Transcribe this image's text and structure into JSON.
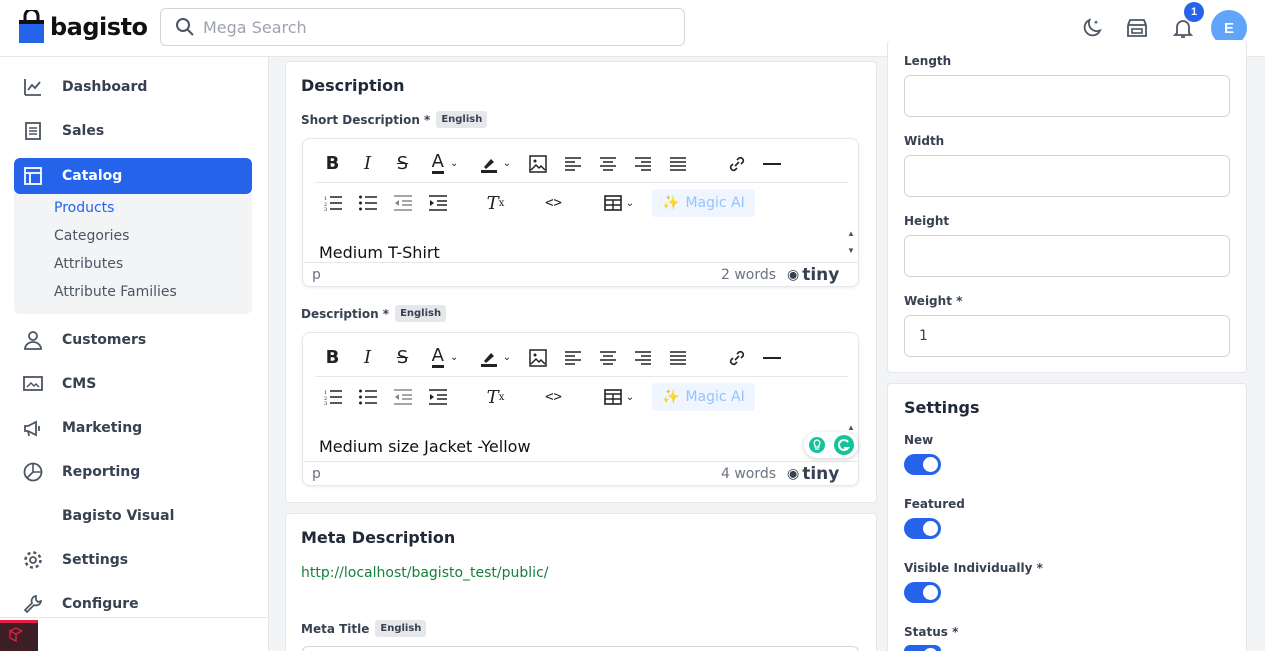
{
  "header": {
    "logo_text": "bagisto",
    "search_placeholder": "Mega Search",
    "notification_count": "1",
    "avatar_initial": "E",
    "accent_color": "#2563eb"
  },
  "sidebar": {
    "items": [
      {
        "label": "Dashboard",
        "icon": "dashboard-icon"
      },
      {
        "label": "Sales",
        "icon": "sales-icon"
      },
      {
        "label": "Catalog",
        "icon": "catalog-icon"
      },
      {
        "label": "Customers",
        "icon": "customers-icon"
      },
      {
        "label": "CMS",
        "icon": "cms-icon"
      },
      {
        "label": "Marketing",
        "icon": "marketing-icon"
      },
      {
        "label": "Reporting",
        "icon": "reporting-icon"
      },
      {
        "label": "Bagisto Visual",
        "icon": ""
      },
      {
        "label": "Settings",
        "icon": "settings-icon"
      },
      {
        "label": "Configure",
        "icon": "configure-icon"
      }
    ],
    "catalog_sub": [
      "Products",
      "Categories",
      "Attributes",
      "Attribute Families"
    ]
  },
  "description_card": {
    "title": "Description",
    "short_label": "Short Description *",
    "short_lang": "English",
    "short_content": "Medium T-Shirt",
    "short_path": "p",
    "short_words": "2 words",
    "desc_label": "Description *",
    "desc_lang": "English",
    "desc_content": "Medium size Jacket -Yellow",
    "desc_path": "p",
    "desc_words": "4 words",
    "magic_ai": "Magic AI",
    "tiny_brand": "tiny"
  },
  "meta_card": {
    "title": "Meta Description",
    "url": "http://localhost/bagisto_test/public/",
    "meta_title_label": "Meta Title",
    "meta_title_lang": "English"
  },
  "shipping_card": {
    "length_label": "Length",
    "width_label": "Width",
    "height_label": "Height",
    "weight_label": "Weight *",
    "weight_value": "1"
  },
  "settings_card": {
    "title": "Settings",
    "toggles": [
      {
        "label": "New",
        "on": true
      },
      {
        "label": "Featured",
        "on": true
      },
      {
        "label": "Visible Individually *",
        "on": true
      },
      {
        "label": "Status *",
        "on": true
      }
    ]
  }
}
